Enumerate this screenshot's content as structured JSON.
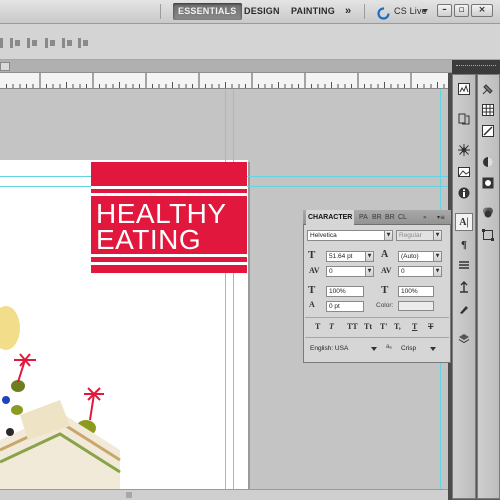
{
  "workspace": {
    "items": [
      "ESSENTIALS",
      "DESIGN",
      "PAINTING"
    ],
    "more_label": "»",
    "cs_live_label": "CS Live"
  },
  "canvas": {
    "logo_lines": [
      "HEALTHY",
      "EATING"
    ]
  },
  "character_panel": {
    "tabs": [
      "CHARACTER",
      "PA",
      "BR",
      "BR",
      "CL"
    ],
    "font_family": "Helvetica",
    "font_style": "Regular",
    "font_size": "51.64 pt",
    "leading": "(Auto)",
    "kerning": "0",
    "tracking": "0",
    "vertical_scale": "100%",
    "horizontal_scale": "100%",
    "baseline_shift": "0 pt",
    "color_label": "Color:",
    "type_styles": [
      "T",
      "T",
      "TT",
      "Tt",
      "T'",
      "T,",
      "T",
      "T"
    ],
    "language": "English: USA",
    "antialias": "Crisp",
    "antialias_code": "aₐ"
  },
  "colors": {
    "logo_red": "#e2173d",
    "guide_cyan": "#66d4e0",
    "cs_live_blue": "#1c6fc0"
  },
  "icons": [
    "minimize-icon",
    "restore-icon",
    "close-icon",
    "cs-live-icon",
    "panel-menu-icon"
  ]
}
